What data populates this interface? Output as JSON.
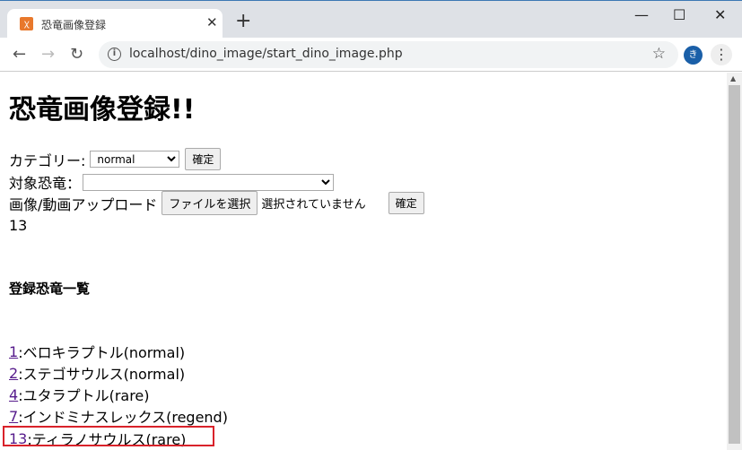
{
  "browser": {
    "tab_title": "恐竜画像登録",
    "url": "localhost/dino_image/start_dino_image.php",
    "profile_initial": "き"
  },
  "page": {
    "title": "恐竜画像登録!!",
    "category_label": "カテゴリー:",
    "category_value": "normal",
    "confirm_label": "確定",
    "target_label": "対象恐竜：",
    "target_value": "",
    "upload_label": "画像/動画アップロード",
    "file_button": "ファイルを選択",
    "file_status": "選択されていません",
    "upload_confirm": "確定",
    "result_number": "13",
    "list_heading": "登録恐竜一覧",
    "dinos": [
      {
        "id": "1",
        "text": ":ベロキラプトル(normal)"
      },
      {
        "id": "2",
        "text": ":ステゴサウルス(normal)"
      },
      {
        "id": "4",
        "text": ":ユタラプトル(rare)"
      },
      {
        "id": "7",
        "text": ":インドミナスレックス(regend)"
      },
      {
        "id": "13",
        "text": ":ティラノサウルス(rare)"
      }
    ]
  },
  "colors": {
    "highlight": "#d9222a",
    "link": "#551a8b"
  }
}
